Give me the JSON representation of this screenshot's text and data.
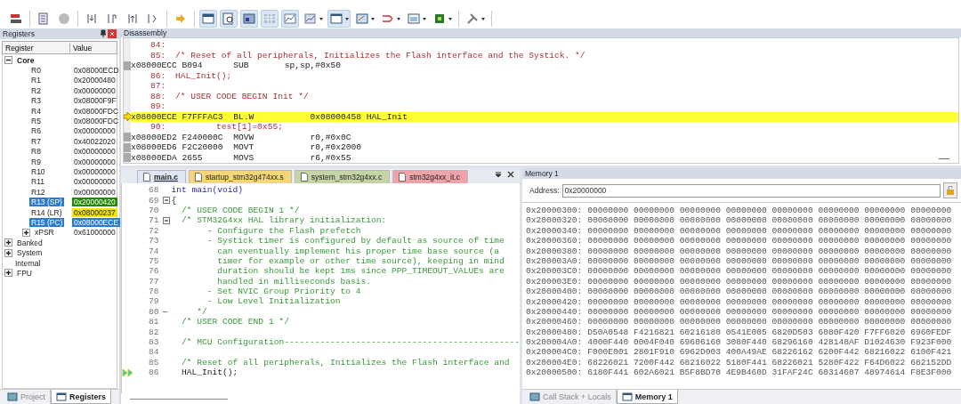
{
  "registers_panel": {
    "title": "Registers",
    "columns": [
      "Register",
      "Value"
    ],
    "tree": [
      {
        "label": "Core",
        "expanded": true,
        "selected": false,
        "children": [
          {
            "label": "R0",
            "value": "0x08000ECD",
            "selected": false
          },
          {
            "label": "R1",
            "value": "0x20000480",
            "selected": false
          },
          {
            "label": "R2",
            "value": "0x00000000",
            "selected": false
          },
          {
            "label": "R3",
            "value": "0x08000F9F",
            "selected": false
          },
          {
            "label": "R4",
            "value": "0x08000FDC",
            "selected": false
          },
          {
            "label": "R5",
            "value": "0x08000FDC",
            "selected": false
          },
          {
            "label": "R6",
            "value": "0x00000000",
            "selected": false
          },
          {
            "label": "R7",
            "value": "0x40022020",
            "selected": false
          },
          {
            "label": "R8",
            "value": "0x00000000",
            "selected": false
          },
          {
            "label": "R9",
            "value": "0x00000000",
            "selected": false
          },
          {
            "label": "R10",
            "value": "0x00000000",
            "selected": false
          },
          {
            "label": "R11",
            "value": "0x00000000",
            "selected": false
          },
          {
            "label": "R12",
            "value": "0x00000000",
            "selected": false
          },
          {
            "label": "R13 (SP)",
            "value": "0x20000420",
            "selected": true,
            "color": "#1f8a00"
          },
          {
            "label": "R14 (LR)",
            "value": "0x08000237",
            "selected": false,
            "color": "#f2e600"
          },
          {
            "label": "R15 (PC)",
            "value": "0x08000ECE",
            "selected": true
          },
          {
            "label": "xPSR",
            "value": "0x61000000",
            "selected": false,
            "expanded": false
          }
        ]
      },
      {
        "label": "Banked",
        "expanded": false,
        "selected": false
      },
      {
        "label": "System",
        "expanded": false,
        "selected": false
      },
      {
        "label": "Internal",
        "selected": false
      },
      {
        "label": "FPU",
        "expanded": false,
        "selected": false
      }
    ],
    "tabs": [
      {
        "label": "Project",
        "selected": false
      },
      {
        "label": "Registers",
        "selected": true
      }
    ]
  },
  "disassembly": {
    "title": "Disassembly",
    "lines": [
      {
        "kind": "source",
        "number": "84:",
        "current": false
      },
      {
        "kind": "source",
        "number": "85:",
        "text": "/* Reset of all peripherals, Initializes the Flash interface and the Systick. */",
        "current": false
      },
      {
        "kind": "asm",
        "text": "x08000ECC B094      SUB       sp,sp,#0x50",
        "current": false
      },
      {
        "kind": "source",
        "number": "86:",
        "text": "HAL_Init();",
        "current": false
      },
      {
        "kind": "source",
        "number": "87:",
        "current": false
      },
      {
        "kind": "source",
        "number": "88:",
        "text": "/* USER CODE BEGIN Init */",
        "current": false
      },
      {
        "kind": "source",
        "number": "89:",
        "current": false
      },
      {
        "kind": "asm",
        "text": "x08000ECE F7FFFAC3  BL.W           0x08000458 HAL_Init",
        "current": true
      },
      {
        "kind": "source",
        "number": "90:",
        "text": "        test[1]=0x55;",
        "current": false
      },
      {
        "kind": "asm",
        "text": "x08000ED2 F240000C  MOVW           r0,#0x0C",
        "current": false
      },
      {
        "kind": "asm",
        "text": "x08000ED6 F2C20000  MOVT           r0,#0x2000",
        "current": false
      },
      {
        "kind": "asm",
        "text": "x08000EDA 2655      MOVS           r6,#0x55",
        "current": false
      }
    ]
  },
  "editor": {
    "tabs": [
      {
        "label": "main.c",
        "selected": true,
        "color": "#dde6f2"
      },
      {
        "label": "startup_stm32g474xx.s",
        "selected": false,
        "color": "#f7d67a"
      },
      {
        "label": "system_stm32g4xx.c",
        "selected": false,
        "color": "#c5d4a4"
      },
      {
        "label": "stm32g4xx_it.c",
        "selected": false,
        "color": "#efa3a8"
      }
    ],
    "lines": [
      {
        "number": "68",
        "kind": "code",
        "text": "int main(void)",
        "current": false
      },
      {
        "number": "69",
        "kind": "plain",
        "expanded": true,
        "text": "{",
        "current": false
      },
      {
        "number": "70",
        "kind": "comment",
        "text": "  /* USER CODE BEGIN 1 */",
        "current": false
      },
      {
        "number": "71",
        "kind": "comment",
        "expanded": true,
        "text": "  /* STM32G4xx HAL library initialization:",
        "current": false
      },
      {
        "number": "72",
        "kind": "comment",
        "text": "       - Configure the Flash prefetch",
        "current": false
      },
      {
        "number": "73",
        "kind": "comment",
        "text": "       - Systick timer is configured by default as source of time",
        "current": false
      },
      {
        "number": "74",
        "kind": "comment",
        "text": "         can eventually implement his proper time base source (a",
        "current": false
      },
      {
        "number": "75",
        "kind": "comment",
        "text": "         timer for example or other time source), keeping in mind",
        "current": false
      },
      {
        "number": "76",
        "kind": "comment",
        "text": "         duration should be kept 1ms since PPP_TIMEOUT_VALUEs are",
        "current": false
      },
      {
        "number": "77",
        "kind": "comment",
        "text": "         handled in milliseconds basis.",
        "current": false
      },
      {
        "number": "78",
        "kind": "comment",
        "text": "       - Set NVIC Group Priority to 4",
        "current": false
      },
      {
        "number": "79",
        "kind": "comment",
        "text": "       - Low Level Initialization",
        "current": false
      },
      {
        "number": "80",
        "kind": "comment",
        "fold_end": true,
        "text": "     */",
        "current": false
      },
      {
        "number": "81",
        "kind": "comment",
        "text": "  /* USER CODE END 1 */",
        "current": false
      },
      {
        "number": "82",
        "kind": "plain",
        "current": false
      },
      {
        "number": "83",
        "kind": "comment",
        "text": "  /* MCU Configuration----------------------------------------------",
        "current": false
      },
      {
        "number": "84",
        "kind": "plain",
        "current": false
      },
      {
        "number": "85",
        "kind": "comment",
        "text": "  /* Reset of all peripherals, Initializes the Flash interface and",
        "current": false
      },
      {
        "number": "86",
        "kind": "plain",
        "text": "  HAL_Init();",
        "current": true
      }
    ]
  },
  "memory": {
    "title": "Memory 1",
    "address_label": "Address:",
    "address": "0x20000000",
    "rows": [
      {
        "address": "0x20000300:",
        "words": [
          "00000000",
          "00000000",
          "00000000",
          "00000000",
          "00000000",
          "00000000",
          "00000000",
          "00000000"
        ]
      },
      {
        "address": "0x20000320:",
        "words": [
          "00000000",
          "00000000",
          "00000000",
          "00000000",
          "00000000",
          "00000000",
          "00000000",
          "00000000"
        ]
      },
      {
        "address": "0x20000340:",
        "words": [
          "00000000",
          "00000000",
          "00000000",
          "00000000",
          "00000000",
          "00000000",
          "00000000",
          "00000000"
        ]
      },
      {
        "address": "0x20000360:",
        "words": [
          "00000000",
          "00000000",
          "00000000",
          "00000000",
          "00000000",
          "00000000",
          "00000000",
          "00000000"
        ]
      },
      {
        "address": "0x20000380:",
        "words": [
          "00000000",
          "00000000",
          "00000000",
          "00000000",
          "00000000",
          "00000000",
          "00000000",
          "00000000"
        ]
      },
      {
        "address": "0x200003A0:",
        "words": [
          "00000000",
          "00000000",
          "00000000",
          "00000000",
          "00000000",
          "00000000",
          "00000000",
          "00000000"
        ]
      },
      {
        "address": "0x200003C0:",
        "words": [
          "00000000",
          "00000000",
          "00000000",
          "00000000",
          "00000000",
          "00000000",
          "00000000",
          "00000000"
        ]
      },
      {
        "address": "0x200003E0:",
        "words": [
          "00000000",
          "00000000",
          "00000000",
          "00000000",
          "00000000",
          "00000000",
          "00000000",
          "00000000"
        ]
      },
      {
        "address": "0x20000400:",
        "words": [
          "00000000",
          "00000000",
          "00000000",
          "00000000",
          "00000000",
          "00000000",
          "00000000",
          "00000000"
        ]
      },
      {
        "address": "0x20000420:",
        "words": [
          "00000000",
          "00000000",
          "00000000",
          "00000000",
          "00000000",
          "00000000",
          "00000000",
          "00000000"
        ]
      },
      {
        "address": "0x20000440:",
        "words": [
          "00000000",
          "00000000",
          "00000000",
          "00000000",
          "00000000",
          "00000000",
          "00000000",
          "00000000"
        ]
      },
      {
        "address": "0x20000460:",
        "words": [
          "00000000",
          "00000000",
          "00000000",
          "00000000",
          "00000000",
          "00000000",
          "00000000",
          "00000000"
        ]
      },
      {
        "address": "0x20000480:",
        "words": [
          "D50A0548",
          "F4216821",
          "60216180",
          "0541E005",
          "6820D503",
          "6080F420",
          "F7FF6020",
          "6960FEDF"
        ]
      },
      {
        "address": "0x200004A0:",
        "words": [
          "4000F440",
          "0004F040",
          "69606160",
          "3080F440",
          "68296160",
          "428148AF",
          "D1024630",
          "F923F000"
        ]
      },
      {
        "address": "0x200004C0:",
        "words": [
          "F000E001",
          "2801F910",
          "6962D003",
          "400A49AE",
          "68226162",
          "6200F442",
          "68216022",
          "6100F421"
        ]
      },
      {
        "address": "0x200004E0:",
        "words": [
          "68226021",
          "7200F442",
          "68216022",
          "5180F441",
          "68226021",
          "5280F422",
          "F64D6022",
          "682152DD"
        ]
      },
      {
        "address": "0x20000500:",
        "words": [
          "6180F441",
          "602A6021",
          "B5F8BD70",
          "4E9B460D",
          "31FAF24C",
          "60314607",
          "48974614",
          "F8E3F000"
        ]
      }
    ],
    "tabs": [
      {
        "label": "Call Stack + Locals",
        "selected": false
      },
      {
        "label": "Memory 1",
        "selected": true
      }
    ]
  }
}
